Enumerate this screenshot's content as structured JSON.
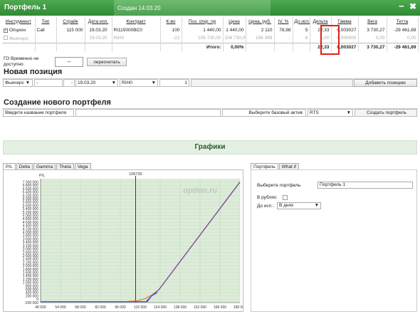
{
  "window": {
    "title": "Портфель 1",
    "created": "Создан 14.03.20",
    "minimize_glyph": "−",
    "close_glyph": "✖"
  },
  "table": {
    "headers": [
      "Инструмент",
      "Тип",
      "Страйк",
      "Дата исп.",
      "Контракт",
      "К-во",
      "Поз. откр. пр",
      "Цена",
      "Цена, руб.",
      "IV, %",
      "До исп.",
      "Дельта",
      "Гамма",
      "Вега",
      "Тетта"
    ],
    "rows": [
      [
        "Опцион",
        "Call",
        "115 000",
        "19.03.20",
        "RI115000BC0",
        "100",
        "1 440,00",
        "1 440,00",
        "2 110",
        "78,98",
        "5",
        "22,33",
        "0,003027",
        "3 730,27",
        "-29 461,69"
      ],
      [
        "Фьючерс",
        "-",
        "-",
        "19.03.20",
        "RIH0",
        "-22",
        "106 730,00",
        "106 730,00",
        "156 399",
        "-",
        "6",
        "1,00",
        "0,000000",
        "0,00",
        "0,00"
      ]
    ],
    "total": {
      "label": "Итого:",
      "pct": "0,00%",
      "delta": "22,33",
      "gamma": "0,003027",
      "vega": "3 730,27",
      "theta": "-29 461,69"
    }
  },
  "go": {
    "label": "ГО Временно не доступно",
    "value": "--",
    "recalc_label": "пересчитать"
  },
  "new_position": {
    "title": "Новая позиция",
    "type": "Фьючерс ▼",
    "f1": "-",
    "f2": "-",
    "date": "19.03.20",
    "contract": "RIH0",
    "qty": "1",
    "add_label": "Добавить позицию"
  },
  "create_portfolio": {
    "title": "Создание нового портфеля",
    "name_placeholder": "Введите название портфеля",
    "base_label": "Выберите базовый актив",
    "base_value": "RTS",
    "create_label": "Создать портфель"
  },
  "graphs": {
    "title": "Графики",
    "tabs": [
      "P/L",
      "Delta",
      "Gamma",
      "Theta",
      "Vega"
    ],
    "right_tabs": [
      "Портфель",
      "What if"
    ],
    "portfolio_label": "Выберите портфель",
    "portfolio_value": "Портфель 1",
    "rub_label": "В рублях:",
    "days_label": "До исп.:",
    "days_value": "В днях",
    "watermark": "option.ru"
  },
  "colors": {
    "green": "#2f8a35",
    "red": "#e0201b",
    "chart_bg": "#dcecd8",
    "orange": "#e8794a",
    "purple": "#7a4aa8",
    "blue": "#3366dd"
  },
  "chart_data": {
    "type": "line",
    "ylabel": "P/L",
    "marker_label": "106730",
    "xlim": [
      40000,
      180000
    ],
    "ylim": [
      -200000,
      7200000
    ],
    "xticks": [
      40000,
      54000,
      68000,
      82000,
      96000,
      110000,
      124000,
      138000,
      152000,
      166000,
      180000
    ],
    "xtick_labels": [
      "40 000",
      "54 000",
      "68 000",
      "82 000",
      "96 000",
      "110 000",
      "124 000",
      "138 000",
      "152 000",
      "166 000",
      "180 000"
    ],
    "yticks": [
      -200000,
      0,
      200000,
      400000,
      600000,
      800000,
      1000000,
      1200000,
      1400000,
      1600000,
      1800000,
      2000000,
      2200000,
      2400000,
      2600000,
      2800000,
      3000000,
      3200000,
      3400000,
      3600000,
      3800000,
      4000000,
      4200000,
      4400000,
      4600000,
      4800000,
      5000000,
      5200000,
      5400000,
      5600000,
      5800000,
      6000000,
      6200000,
      6400000,
      6600000,
      6800000,
      7000000
    ],
    "ytick_labels": [
      "-200 000",
      "0",
      "200 000",
      "400 000",
      "600 000",
      "800 000",
      "1 000 000",
      "1 200 000",
      "1 400 000",
      "1 600 000",
      "1 800 000",
      "2 000 000",
      "2 200 000",
      "2 400 000",
      "2 600 000",
      "2 800 000",
      "3 000 000",
      "3 200 000",
      "3 400 000",
      "3 600 000",
      "3 800 000",
      "4 000 000",
      "4 200 000",
      "4 400 000",
      "4 600 000",
      "4 800 000",
      "5 000 000",
      "5 200 000",
      "5 400 000",
      "5 600 000",
      "5 800 000",
      "6 000 000",
      "6 200 000",
      "6 400 000",
      "6 600 000",
      "6 800 000",
      "7 000 000"
    ],
    "vline_x": 106730,
    "series": [
      {
        "color": "#e8794a",
        "x": [
          40000,
          100000,
          108000,
          113000,
          118000,
          123000,
          180000
        ],
        "y": [
          -140000,
          -140000,
          -90000,
          20000,
          250000,
          560000,
          7000000
        ]
      },
      {
        "color": "#7a4aa8",
        "x": [
          40000,
          100000,
          115000,
          118000,
          123000,
          180000
        ],
        "y": [
          -140000,
          -140000,
          -140000,
          200000,
          560000,
          7000000
        ]
      },
      {
        "color": "#3366dd",
        "x": [
          40000,
          114000,
          118000,
          122000
        ],
        "y": [
          -140000,
          -140000,
          200000,
          400000
        ]
      }
    ]
  }
}
